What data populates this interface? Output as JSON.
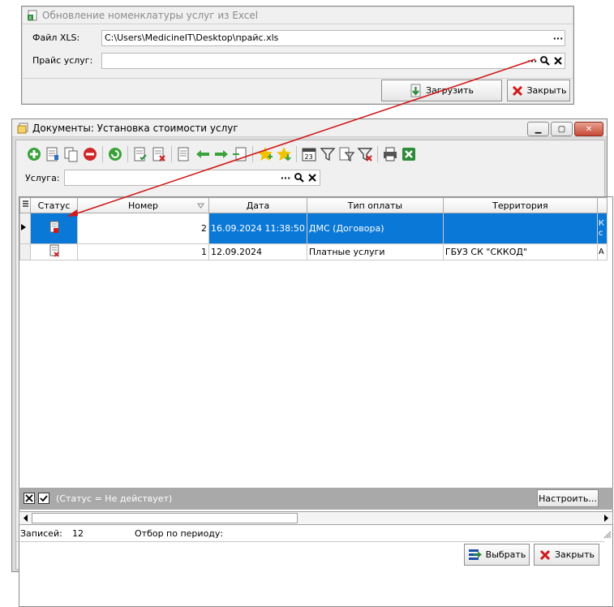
{
  "import_dialog": {
    "title": "Обновление номенклатуры услуг из Excel",
    "file_label": "Файл XLS:",
    "file_value": "C:\\Users\\MedicineIT\\Desktop\\прайс.xls",
    "price_label": "Прайс услуг:",
    "price_value": "",
    "ellipsis": "···",
    "load_button": "Загрузить",
    "close_button": "Закрыть"
  },
  "docs_window": {
    "title": "Документы: Установка стоимости услуг",
    "service_label": "Услуга:",
    "service_value": "",
    "ellipsis": "···",
    "columns": [
      "Статус",
      "Номер",
      "Дата",
      "Тип оплаты",
      "Территория"
    ],
    "rows": [
      {
        "number": "2",
        "date": "16.09.2024 11:38:50",
        "payment": "ДМС (Договора)",
        "territory": "",
        "extra": "К",
        "extra2": "с"
      },
      {
        "number": "1",
        "date": "12.09.2024",
        "payment": "Платные услуги",
        "territory": "ГБУЗ СК \"СККОД\"",
        "extra": "А"
      }
    ],
    "filter_text": "(Статус = Не действует)",
    "configure_button": "Настроить...",
    "records_label": "Записей:",
    "records_count": "12",
    "period_label": "Отбор по периоду:",
    "select_button": "Выбрать",
    "close_button": "Закрыть"
  },
  "colors": {
    "selection": "#0a78d7",
    "arrow": "#d01a1a",
    "filter_bar": "#a9a9a9"
  }
}
